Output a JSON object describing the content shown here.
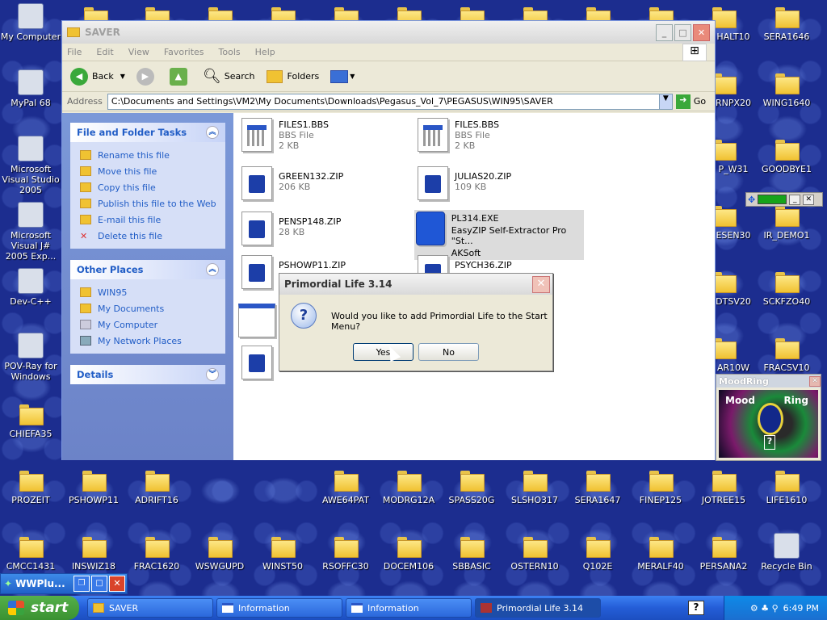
{
  "desktop": {
    "left_icons": [
      {
        "label": "My Computer"
      },
      {
        "label": "MyPal 68"
      },
      {
        "label": "Microsoft Visual Studio 2005"
      },
      {
        "label": "Microsoft Visual J# 2005 Exp..."
      },
      {
        "label": "Dev-C++"
      },
      {
        "label": "POV-Ray for Windows"
      },
      {
        "label": "CHIEFA35"
      }
    ],
    "right_icons": [
      {
        "label": "HALT10"
      },
      {
        "label": "SERA1646"
      },
      {
        "label": "RNPX20"
      },
      {
        "label": "WING1640"
      },
      {
        "label": "P_W31"
      },
      {
        "label": "GOODBYE1"
      },
      {
        "label": "ESEN30"
      },
      {
        "label": "IR_DEMO1"
      },
      {
        "label": "DTSV20"
      },
      {
        "label": "SCKFZO40"
      },
      {
        "label": "AR10W"
      },
      {
        "label": "FRACSV10"
      }
    ],
    "row1_icons": [
      "PROZEIT",
      "PSHOWP11",
      "ADRIFT16",
      "AWE64PAT",
      "MODRG12A",
      "SPASS20G",
      "SLSHO317",
      "SERA1647",
      "FINEP125",
      "JOTREE15",
      "LIFE1610"
    ],
    "row2_icons": [
      "CMCC1431",
      "INSWIZ18",
      "FRAC1620",
      "WSWGUPD",
      "WINST50",
      "RSOFFC30",
      "DOCEM106",
      "SBBASIC",
      "OSTERN10",
      "Q102E",
      "MERALF40",
      "PERSANA2",
      "Recycle Bin"
    ]
  },
  "explorer": {
    "title": "SAVER",
    "menu": [
      "File",
      "Edit",
      "View",
      "Favorites",
      "Tools",
      "Help"
    ],
    "toolbar": {
      "back": "Back",
      "search": "Search",
      "folders": "Folders"
    },
    "address_label": "Address",
    "address_value": "C:\\Documents and Settings\\VM2\\My Documents\\Downloads\\Pegasus_Vol_7\\PEGASUS\\WIN95\\SAVER",
    "go_label": "Go",
    "tasks": {
      "title": "File and Folder Tasks",
      "items": [
        "Rename this file",
        "Move this file",
        "Copy this file",
        "Publish this file to the Web",
        "E-mail this file",
        "Delete this file"
      ]
    },
    "places": {
      "title": "Other Places",
      "items": [
        "WIN95",
        "My Documents",
        "My Computer",
        "My Network Places"
      ]
    },
    "details": {
      "title": "Details"
    },
    "files": [
      {
        "name": "FILES1.BBS",
        "type": "BBS File",
        "size": "2 KB"
      },
      {
        "name": "FILES.BBS",
        "type": "BBS File",
        "size": "2 KB"
      },
      {
        "name": "GREEN132.ZIP",
        "type": "",
        "size": "206 KB"
      },
      {
        "name": "JULIAS20.ZIP",
        "type": "",
        "size": "109 KB"
      },
      {
        "name": "PENSP148.ZIP",
        "type": "",
        "size": "28 KB"
      },
      {
        "name": "PL314.EXE",
        "type": "EasyZIP Self-Extractor Pro \"St...",
        "size": "AKSoft"
      },
      {
        "name": "PSHOWP11.ZIP",
        "type": "",
        "size": ""
      },
      {
        "name": "PSYCH36.ZIP",
        "type": "",
        "size": ""
      }
    ]
  },
  "dialog": {
    "title": "Primordial Life 3.14",
    "message": "Would you like to add Primordial Life to the Start Menu?",
    "yes": "Yes",
    "no": "No"
  },
  "moodring": {
    "title": "MoodRing",
    "left": "Mood",
    "right": "Ring",
    "help": "?"
  },
  "wwplu": {
    "title": "WWPlu..."
  },
  "taskbar": {
    "start": "start",
    "tasks": [
      {
        "label": "SAVER"
      },
      {
        "label": "Information"
      },
      {
        "label": "Information"
      },
      {
        "label": "Primordial Life 3.14"
      }
    ],
    "clock": "6:49 PM"
  }
}
